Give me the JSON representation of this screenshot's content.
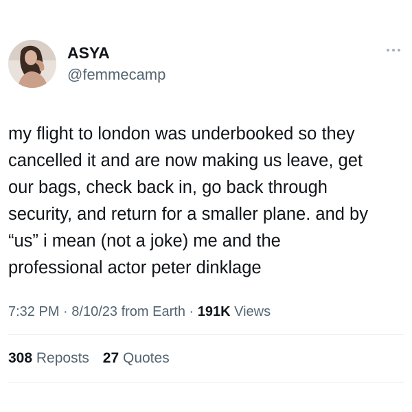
{
  "author": {
    "display_name": "ASYA",
    "handle": "@femmecamp",
    "avatar_icon": "profile-photo"
  },
  "more_icon": "more-horizontal-icon",
  "tweet": {
    "text": "my flight to london was underbooked so they\ncancelled it and are now making us leave, get\nour bags, check back in, go back through\nsecurity, and return for a smaller plane. and by\n“us” i mean (not a joke) me and the\nprofessional actor peter dinklage"
  },
  "meta": {
    "time": "7:32 PM",
    "date": "8/10/23",
    "source": "from Earth",
    "separator": "·",
    "views_count": "191K",
    "views_label": "Views"
  },
  "stats": {
    "reposts_count": "308",
    "reposts_label": "Reposts",
    "quotes_count": "27",
    "quotes_label": "Quotes"
  },
  "colors": {
    "text_primary": "#0f1419",
    "text_secondary": "#536471",
    "divider": "#e6ecf0"
  }
}
